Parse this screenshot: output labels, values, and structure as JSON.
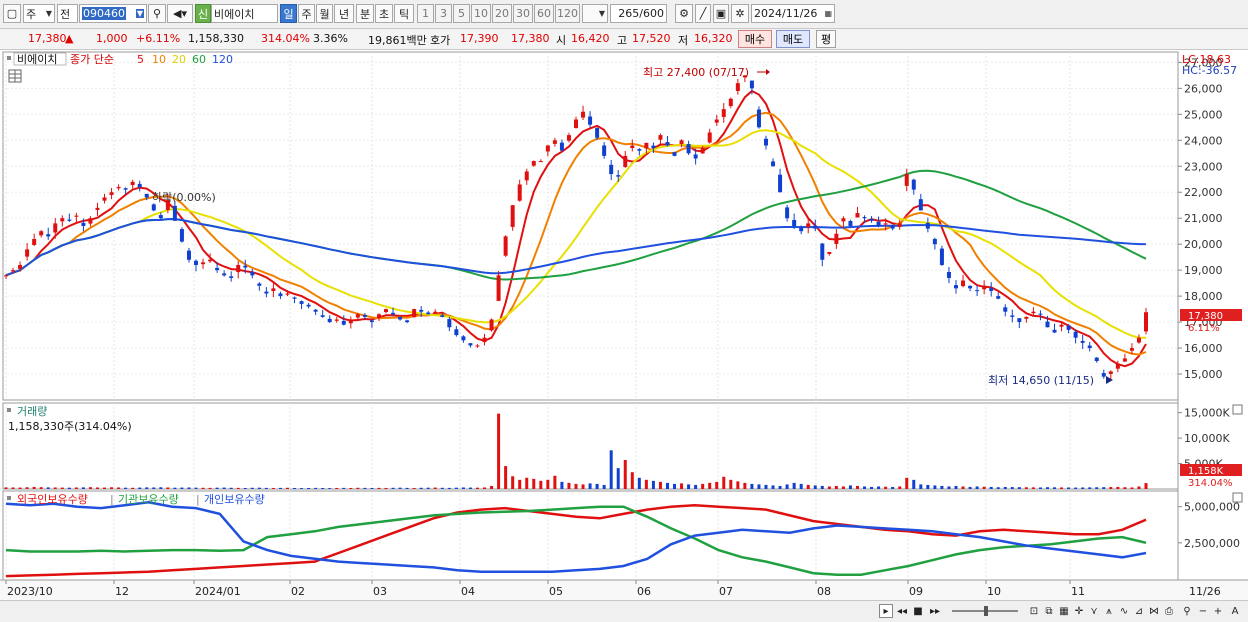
{
  "toolbar": {
    "period_select": "주",
    "prev_label": "전",
    "stock_code": "090460",
    "stock_badge": "신",
    "stock_name": "비에이치",
    "timeframes": [
      "일",
      "주",
      "월",
      "년",
      "분",
      "초",
      "틱"
    ],
    "active_timeframe": "일",
    "minute_options": [
      "1",
      "3",
      "5",
      "10",
      "20",
      "30",
      "60",
      "120"
    ],
    "count_display": "265",
    "count_total": "/600",
    "date": "2024/11/26"
  },
  "quote": {
    "price": "17,380",
    "arrow": "▲",
    "change": "1,000",
    "change_pct": "+6.11%",
    "volume": "1,158,330",
    "volume_ratio": "314.04%",
    "turnover": "3.36%",
    "amount": "19,861백만",
    "bid_label": "호가",
    "bid_value": "17,390",
    "ask_value": "17,380",
    "open_label": "시",
    "open_value": "16,420",
    "high_label": "고",
    "high_value": "17,520",
    "low_label": "저",
    "low_value": "16,320",
    "buy_label": "매수",
    "sell_label": "매도",
    "eval_label": "평"
  },
  "chart_data": [
    {
      "type": "candlestick",
      "name": "비에이치",
      "legend": {
        "name": "비에이치",
        "ma_label": "종가 단순",
        "periods": [
          "5",
          "10",
          "20",
          "60",
          "120"
        ],
        "colors": [
          "#e01010",
          "#f08000",
          "#e8e000",
          "#20a040",
          "#2050e0"
        ]
      },
      "y_ticks": [
        "27,000",
        "26,000",
        "25,000",
        "24,000",
        "23,000",
        "22,000",
        "21,000",
        "20,000",
        "19,000",
        "18,000",
        "17,000",
        "16,000",
        "15,000"
      ],
      "ylim": [
        14000,
        27400
      ],
      "x_ticks": [
        "2023/10",
        "12",
        "2024/01",
        "02",
        "03",
        "04",
        "05",
        "06",
        "07",
        "08",
        "09",
        "10",
        "11",
        "11/26"
      ],
      "lc_label": "LC:18.63",
      "hc_label": "HC:-36.57",
      "current_price_label": "17,380",
      "current_change_label": "6.11%",
      "annotations": {
        "high": "최고 27,400 (07/17)",
        "low": "최저 14,650 (11/15)",
        "drop": "하락(0.00%)"
      },
      "closes": [
        18800,
        19000,
        19200,
        19800,
        20200,
        20500,
        20300,
        20800,
        21000,
        20900,
        21100,
        20700,
        21000,
        21400,
        21800,
        22000,
        22200,
        22100,
        22400,
        22200,
        21800,
        21300,
        21000,
        21700,
        20900,
        20100,
        19400,
        19200,
        19300,
        19400,
        19000,
        18800,
        18700,
        19200,
        19100,
        18800,
        18400,
        18100,
        18300,
        18000,
        18100,
        17900,
        17700,
        17600,
        17400,
        17200,
        17000,
        17100,
        16900,
        17100,
        17300,
        17200,
        17000,
        17300,
        17500,
        17300,
        17100,
        17000,
        17500,
        17400,
        17300,
        17400,
        17200,
        16800,
        16500,
        16300,
        16100,
        16100,
        16400,
        17100,
        18800,
        20300,
        21500,
        22300,
        22800,
        23200,
        23200,
        23800,
        24000,
        23600,
        24200,
        24800,
        25100,
        24600,
        24100,
        23400,
        22700,
        22600,
        23400,
        23800,
        23600,
        23900,
        23700,
        24200,
        23800,
        23400,
        24000,
        23500,
        23300,
        23700,
        24300,
        24800,
        25200,
        25600,
        26200,
        26500,
        26000,
        24500,
        23800,
        23000,
        22000,
        21000,
        20700,
        20500,
        20800,
        20600,
        19400,
        19700,
        20400,
        21000,
        20700,
        21200,
        21000,
        20900,
        20700,
        20800,
        20600,
        20800,
        22700,
        22100,
        21300,
        20600,
        20000,
        19200,
        18700,
        18300,
        18600,
        18300,
        18200,
        18400,
        18200,
        17900,
        17400,
        17200,
        17000,
        17200,
        17400,
        17300,
        16800,
        16600,
        16900,
        16700,
        16400,
        16200,
        16000,
        15500,
        14900,
        15100,
        15400,
        15600,
        16000,
        16400,
        17380
      ],
      "volumes_k": [
        320,
        300,
        280,
        340,
        400,
        360,
        320,
        300,
        280,
        260,
        300,
        320,
        360,
        300,
        280,
        340,
        300,
        260,
        240,
        280,
        320,
        300,
        340,
        300,
        260,
        280,
        300,
        260,
        240,
        220,
        260,
        280,
        240,
        220,
        200,
        240,
        260,
        220,
        200,
        220,
        240,
        200,
        180,
        200,
        220,
        200,
        180,
        200,
        220,
        200,
        240,
        220,
        200,
        220,
        200,
        240,
        260,
        220,
        200,
        240,
        260,
        280,
        240,
        220,
        260,
        300,
        280,
        260,
        300,
        600,
        14800,
        4500,
        2500,
        1800,
        2200,
        2000,
        1600,
        1800,
        2600,
        1400,
        1200,
        1000,
        900,
        1100,
        1000,
        800,
        7600,
        4100,
        5700,
        3300,
        2200,
        1800,
        1600,
        1400,
        1200,
        1000,
        1100,
        900,
        800,
        1000,
        1200,
        1400,
        2400,
        1800,
        1500,
        1200,
        1000,
        900,
        800,
        700,
        600,
        900,
        1200,
        1000,
        800,
        700,
        600,
        500,
        600,
        500,
        700,
        600,
        500,
        400,
        500,
        450,
        400,
        500,
        2200,
        1800,
        900,
        800,
        700,
        600,
        500,
        600,
        500,
        400,
        500,
        450,
        400,
        350,
        400,
        380,
        360,
        340,
        320,
        300,
        350,
        330,
        310,
        300,
        280,
        300,
        320,
        340,
        360,
        380,
        400,
        350,
        300,
        500,
        1158
      ],
      "volume_panel": {
        "title": "거래량",
        "value": "1,158,330주(314.04%)",
        "y_ticks": [
          "15,000K",
          "10,000K",
          "5,000K"
        ],
        "current_label": "1,158K",
        "current_pct": "314.04%"
      },
      "holding_panel": {
        "titles": [
          "외국인보유수량",
          "기관보유수량",
          "개인보유수량"
        ],
        "colors": [
          "#e01010",
          "#20a040",
          "#2050e0"
        ],
        "y_ticks": [
          "5,000,000",
          "2,500,000"
        ],
        "series": [
          {
            "name": "외국인보유수량",
            "values": [
              200000,
              250000,
              300000,
              350000,
              400000,
              450000,
              500000,
              600000,
              700000,
              800000,
              900000,
              1000000,
              1100000,
              1200000,
              1800000,
              2400000,
              3000000,
              3600000,
              4200000,
              4600000,
              4800000,
              4900000,
              4700000,
              4500000,
              4300000,
              4200000,
              4500000,
              4800000,
              5000000,
              5100000,
              5000000,
              4900000,
              4800000,
              4400000,
              4000000,
              3800000,
              3600000,
              3400000,
              3300000,
              3100000,
              3000000,
              3300000,
              3400000,
              3300000,
              3200000,
              3100000,
              3100000,
              3400000,
              4100000
            ]
          },
          {
            "name": "기관보유수량",
            "values": [
              2000000,
              1900000,
              1900000,
              1900000,
              1950000,
              1900000,
              1950000,
              2000000,
              2000000,
              1950000,
              2000000,
              2900000,
              3100000,
              3300000,
              3600000,
              3800000,
              4000000,
              4200000,
              4400000,
              4500000,
              4600000,
              4650000,
              4700000,
              4800000,
              4900000,
              5000000,
              5000000,
              4300000,
              3500000,
              2800000,
              2000000,
              1500000,
              1200000,
              800000,
              400000,
              300000,
              300000,
              600000,
              900000,
              1300000,
              1700000,
              2000000,
              2200000,
              2300000,
              2400000,
              2600000,
              2800000,
              2900000,
              2500000
            ]
          },
          {
            "name": "개인보유수량",
            "values": [
              5200000,
              5100000,
              5200000,
              5000000,
              4900000,
              5100000,
              5300000,
              5000000,
              4900000,
              4500000,
              2600000,
              2000000,
              1600000,
              1400000,
              1200000,
              1100000,
              1000000,
              900000,
              800000,
              600000,
              500000,
              500000,
              500000,
              500000,
              600000,
              700000,
              900000,
              1400000,
              2400000,
              3000000,
              3200000,
              3400000,
              3300000,
              3200000,
              3500000,
              3700000,
              3600000,
              3500000,
              3400000,
              3300000,
              3100000,
              2900000,
              2600000,
              2300000,
              2100000,
              1900000,
              1700000,
              1500000,
              1800000
            ]
          }
        ]
      }
    }
  ],
  "statusbar": {
    "nav_icons": [
      "▸",
      "◂◂",
      "■",
      "▸▸"
    ],
    "zoom_icons": [
      "−",
      "+",
      "A"
    ]
  }
}
